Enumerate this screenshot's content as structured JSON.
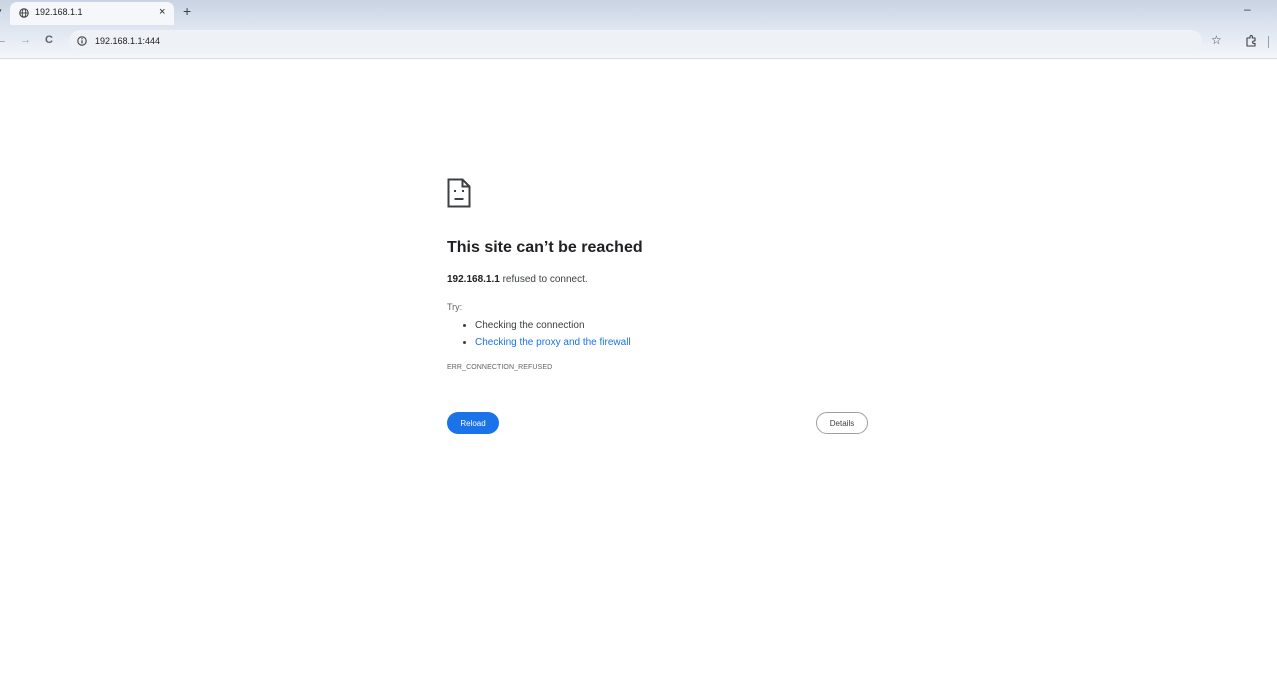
{
  "browser": {
    "tab": {
      "title": "192.168.1.1",
      "favicon": "globe-icon",
      "close_glyph": "×"
    },
    "new_tab_glyph": "+",
    "minimize_glyph": "–",
    "nav": {
      "back_glyph": "←",
      "forward_glyph": "→",
      "reload_glyph": "C"
    },
    "address_bar": {
      "url": "192.168.1.1:444",
      "icon": "info-icon"
    },
    "bookmark_glyph": "☆",
    "extensions_icon": "puzzle-icon"
  },
  "error_page": {
    "icon": "sad-page-icon",
    "heading": "This site can’t be reached",
    "host": "192.168.1.1",
    "message": " refused to connect.",
    "try_label": "Try:",
    "suggestions": [
      "Checking the connection",
      "Checking the proxy and the firewall"
    ],
    "error_code": "ERR_CONNECTION_REFUSED",
    "reload_label": "Reload",
    "details_label": "Details",
    "colors": {
      "accent": "#1a73e8",
      "text": "#202124",
      "muted": "#5f6368"
    }
  }
}
